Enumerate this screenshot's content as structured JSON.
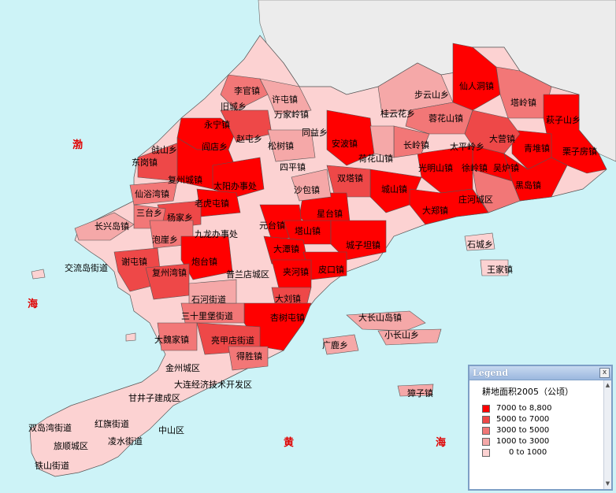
{
  "colors": {
    "sea": "#cdf3f7",
    "land_grey": "#ececec",
    "class5": "#ff0000",
    "class4": "#ee4848",
    "class3": "#f27777",
    "class2": "#f5a8a8",
    "class1": "#fcd2d2"
  },
  "sea_labels": {
    "bo1": "渤",
    "hai1": "海",
    "huang": "黄",
    "hai2": "海"
  },
  "places": [
    {
      "name": "李官镇",
      "cls": 3
    },
    {
      "name": "旧城乡",
      "cls": 1
    },
    {
      "name": "许屯镇",
      "cls": 2
    },
    {
      "name": "万家岭镇",
      "cls": 2
    },
    {
      "name": "永宁镇",
      "cls": 5
    },
    {
      "name": "赵屯乡",
      "cls": 4
    },
    {
      "name": "同益乡",
      "cls": 1
    },
    {
      "name": "安波镇",
      "cls": 5
    },
    {
      "name": "步云山乡",
      "cls": 2
    },
    {
      "name": "仙人洞镇",
      "cls": 5
    },
    {
      "name": "塔岭镇",
      "cls": 3
    },
    {
      "name": "桂云花乡",
      "cls": 2
    },
    {
      "name": "蓉花山镇",
      "cls": 3
    },
    {
      "name": "荷花山镇",
      "cls": 2
    },
    {
      "name": "长岭镇",
      "cls": 3
    },
    {
      "name": "大营镇",
      "cls": 4
    },
    {
      "name": "萩子山乡",
      "cls": 5
    },
    {
      "name": "太平岭乡",
      "cls": 4
    },
    {
      "name": "吴炉镇",
      "cls": 5
    },
    {
      "name": "青堆镇",
      "cls": 5
    },
    {
      "name": "栗子房镇",
      "cls": 5
    },
    {
      "name": "光明山镇",
      "cls": 5
    },
    {
      "name": "徐岭镇",
      "cls": 5
    },
    {
      "name": "黑岛镇",
      "cls": 5
    },
    {
      "name": "庄河城区",
      "cls": 3
    },
    {
      "name": "双塔镇",
      "cls": 4
    },
    {
      "name": "城山镇",
      "cls": 5
    },
    {
      "name": "大郑镇",
      "cls": 5
    },
    {
      "name": "戗山乡",
      "cls": 4
    },
    {
      "name": "阎店乡",
      "cls": 5
    },
    {
      "name": "松树镇",
      "cls": 2
    },
    {
      "name": "四平镇",
      "cls": 1
    },
    {
      "name": "东岗镇",
      "cls": 4
    },
    {
      "name": "复州城镇",
      "cls": 5
    },
    {
      "name": "太阳办事处",
      "cls": 5
    },
    {
      "name": "沙包镇",
      "cls": 2
    },
    {
      "name": "仙浴湾镇",
      "cls": 3
    },
    {
      "name": "老虎屯镇",
      "cls": 5
    },
    {
      "name": "星台镇",
      "cls": 5
    },
    {
      "name": "三台乡",
      "cls": 3
    },
    {
      "name": "杨家乡",
      "cls": 4
    },
    {
      "name": "长兴岛镇",
      "cls": 2
    },
    {
      "name": "元台镇",
      "cls": 5
    },
    {
      "name": "塔山镇",
      "cls": 5
    },
    {
      "name": "泡崖乡",
      "cls": 3
    },
    {
      "name": "九龙办事处",
      "cls": 1
    },
    {
      "name": "城子坦镇",
      "cls": 5
    },
    {
      "name": "交流岛街道",
      "cls": 1
    },
    {
      "name": "谢屯镇",
      "cls": 4
    },
    {
      "name": "炮台镇",
      "cls": 5
    },
    {
      "name": "大潭镇",
      "cls": 5
    },
    {
      "name": "复州湾镇",
      "cls": 4
    },
    {
      "name": "普兰店城区",
      "cls": 1
    },
    {
      "name": "夹河镇",
      "cls": 5
    },
    {
      "name": "皮口镇",
      "cls": 5
    },
    {
      "name": "石河街道",
      "cls": 2
    },
    {
      "name": "大刘镇",
      "cls": 4
    },
    {
      "name": "三十里堡街道",
      "cls": 3
    },
    {
      "name": "杏树屯镇",
      "cls": 5
    },
    {
      "name": "大长山岛镇",
      "cls": 2
    },
    {
      "name": "大魏家镇",
      "cls": 3
    },
    {
      "name": "亮甲店街道",
      "cls": 4
    },
    {
      "name": "小长山乡",
      "cls": 2
    },
    {
      "name": "广鹿乡",
      "cls": 2
    },
    {
      "name": "得胜镇",
      "cls": 3
    },
    {
      "name": "金州城区",
      "cls": 1
    },
    {
      "name": "大连经济技术开发区",
      "cls": 1
    },
    {
      "name": "獐子镇",
      "cls": 2
    },
    {
      "name": "甘井子建成区",
      "cls": 1
    },
    {
      "name": "双岛湾街道",
      "cls": 1
    },
    {
      "name": "红旗街道",
      "cls": 1
    },
    {
      "name": "中山区",
      "cls": 1
    },
    {
      "name": "旅顺城区",
      "cls": 1
    },
    {
      "name": "凌水街道",
      "cls": 1
    },
    {
      "name": "铁山街道",
      "cls": 1
    },
    {
      "name": "石城乡",
      "cls": 1
    },
    {
      "name": "王家镇",
      "cls": 1
    }
  ],
  "legend": {
    "title": "Legend",
    "close": "x",
    "heading": "耕地面积2005（公顷）",
    "classes": [
      {
        "label": "7000 to 8,800",
        "color": "#ff0000"
      },
      {
        "label": "5000 to  7000",
        "color": "#ee4848"
      },
      {
        "label": "3000 to  5000",
        "color": "#f27777"
      },
      {
        "label": "1000 to  3000",
        "color": "#f5a8a8"
      },
      {
        "label": "0 to  1000",
        "color": "#fcd2d2"
      }
    ]
  }
}
